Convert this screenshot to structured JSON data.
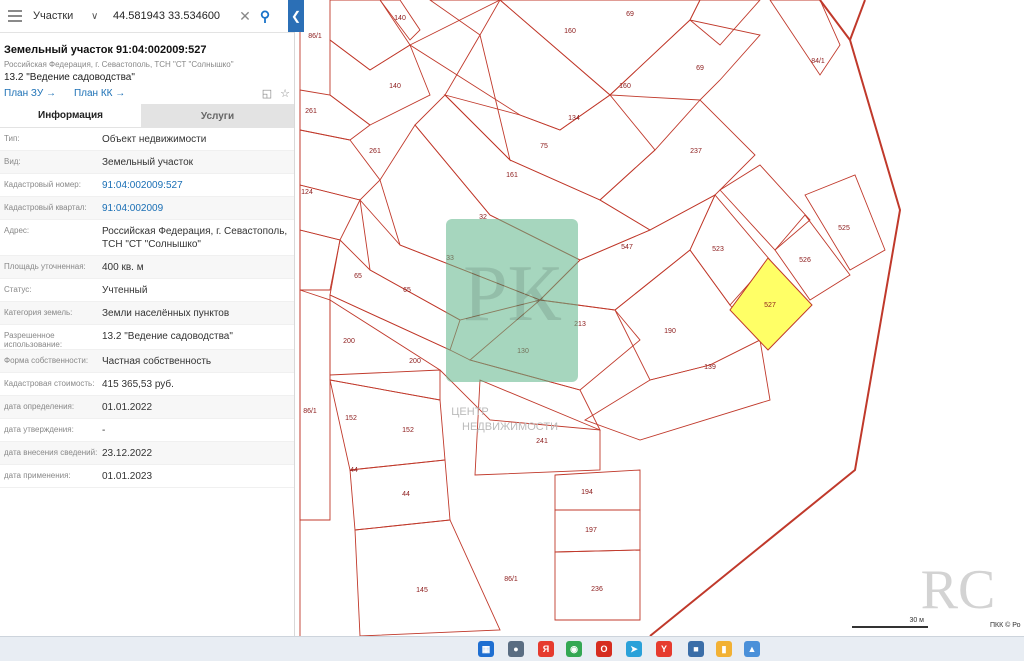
{
  "search": {
    "layer": "Участки",
    "query": "44.581943 33.534600"
  },
  "parcel": {
    "title": "Земельный участок 91:04:002009:527",
    "address": "Российская Федерация, г. Севастополь, ТСН \"СТ \"Солнышко\"",
    "use": "13.2 \"Ведение садоводства\"",
    "links": [
      "План ЗУ →",
      "План КК →"
    ]
  },
  "tabs": [
    "Информация",
    "Услуги"
  ],
  "fields": [
    {
      "label": "Тип:",
      "value": "Объект недвижимости"
    },
    {
      "label": "Вид:",
      "value": "Земельный участок"
    },
    {
      "label": "Кадастровый номер:",
      "value": "91:04:002009:527"
    },
    {
      "label": "Кадастровый квартал:",
      "value": "91:04:002009"
    },
    {
      "label": "Адрес:",
      "value": "Российская Федерация, г. Севастополь, ТСН \"СТ \"Солнышко\""
    },
    {
      "label": "Площадь уточненная:",
      "value": "400 кв. м"
    },
    {
      "label": "Статус:",
      "value": "Учтенный"
    },
    {
      "label": "Категория земель:",
      "value": "Земли населённых пунктов"
    },
    {
      "label": "Разрешенное использование:",
      "value": "13.2 \"Ведение садоводства\""
    },
    {
      "label": "Форма собственности:",
      "value": "Частная собственность"
    },
    {
      "label": "Кадастровая стоимость:",
      "value": "415 365,53 руб."
    },
    {
      "label": "дата определения:",
      "value": "01.01.2022"
    },
    {
      "label": "дата утверждения:",
      "value": "-"
    },
    {
      "label": "дата внесения сведений:",
      "value": "23.12.2022"
    },
    {
      "label": "дата применения:",
      "value": "01.01.2023"
    }
  ],
  "map": {
    "labels": [
      "140",
      "69",
      "160",
      "86/1",
      "69",
      "84/1",
      "261",
      "140",
      "160",
      "134",
      "75",
      "237",
      "261",
      "161",
      "124",
      "32",
      "525",
      "547",
      "523",
      "526",
      "33",
      "65",
      "527",
      "65",
      "213",
      "190",
      "130",
      "200",
      "200",
      "139",
      "86/1",
      "152",
      "152",
      "241",
      "44",
      "194",
      "44",
      "197",
      "86/1",
      "145",
      "236"
    ],
    "selected_color": "#ffff66",
    "line_color": "#c0392b",
    "scale_label": "30 м",
    "copyright": "ПКК © Ро",
    "watermark_text": [
      "ЦЕНТР",
      "НЕДВИЖИМОСТИ"
    ]
  }
}
